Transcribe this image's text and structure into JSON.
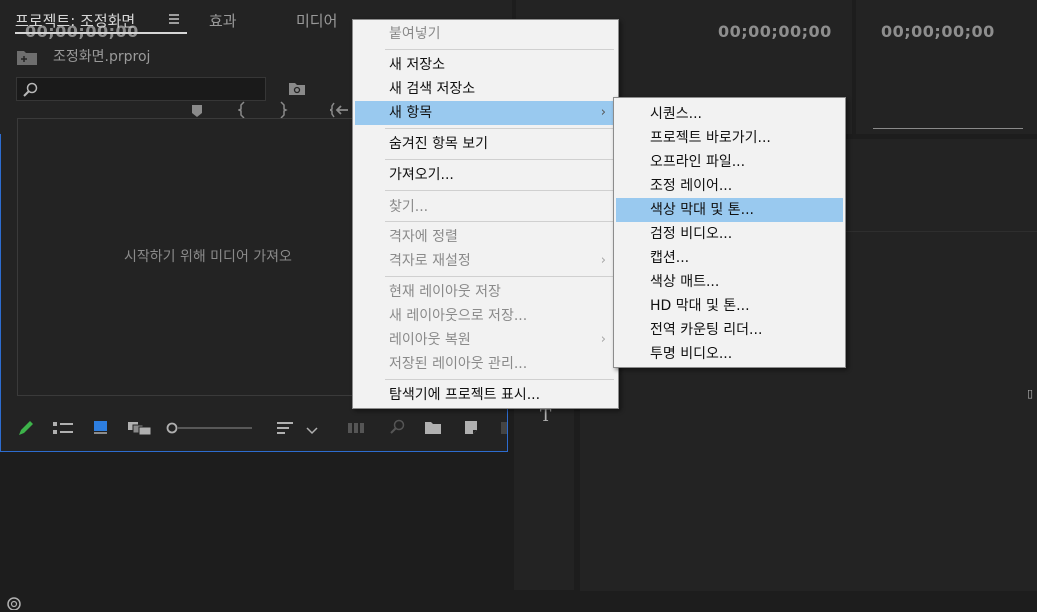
{
  "timecodes": {
    "left": "00;00;00;00",
    "center": "00;00;00;00",
    "right": "00;00;00;00"
  },
  "project_panel": {
    "tabs": [
      "프로젝트: 조정화면",
      "효과",
      "미디어"
    ],
    "file_name": "조정화면.prproj",
    "empty_message": "시작하기 위해 미디어 가져오"
  },
  "context_menu": {
    "items": [
      {
        "label": "붙여넣기",
        "disabled": true
      },
      {
        "label": "새 저장소",
        "disabled": false
      },
      {
        "label": "새 검색 저장소",
        "disabled": false
      },
      {
        "label": "새 항목",
        "disabled": false,
        "submenu": true,
        "highlight": true
      },
      {
        "label": "숨겨진 항목 보기",
        "disabled": false
      },
      {
        "label": "가져오기...",
        "disabled": false
      },
      {
        "label": "찾기...",
        "disabled": true
      },
      {
        "label": "격자에 정렬",
        "disabled": true
      },
      {
        "label": "격자로 재설정",
        "disabled": true,
        "submenu": true
      },
      {
        "label": "현재 레이아웃 저장",
        "disabled": true
      },
      {
        "label": "새 레이아웃으로 저장...",
        "disabled": true
      },
      {
        "label": "레이아웃 복원",
        "disabled": true,
        "submenu": true
      },
      {
        "label": "저장된 레이아웃 관리...",
        "disabled": true
      },
      {
        "label": "탐색기에 프로젝트 표시...",
        "disabled": false
      }
    ]
  },
  "submenu": {
    "items": [
      "시퀀스...",
      "프로젝트 바로가기...",
      "오프라인 파일...",
      "조정 레이어...",
      "색상 막대 및 톤...",
      "검정 비디오...",
      "캡션...",
      "색상 매트...",
      "HD 막대 및 톤...",
      "전역 카운팅 리더...",
      "투명 비디오..."
    ],
    "highlighted": "색상 막대 및 톤..."
  },
  "colors": {
    "panel_bg": "#232323",
    "accent_blue": "#2d6ccf",
    "menu_bg": "#f2f2f2",
    "menu_highlight": "#99c9ef"
  }
}
